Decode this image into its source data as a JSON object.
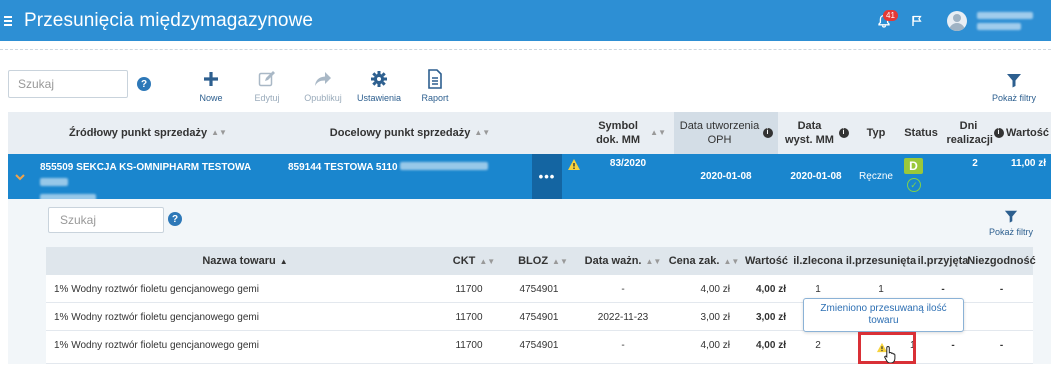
{
  "app": {
    "title": "Przesunięcia międzymagazynowe",
    "notifications_count": "41",
    "accent": "#2d8fd4"
  },
  "toolbar": {
    "search_placeholder": "Szukaj",
    "help_label": "?",
    "actions": [
      {
        "label": "Nowe",
        "icon": "plus-icon",
        "enabled": true
      },
      {
        "label": "Edytuj",
        "icon": "edit-icon",
        "enabled": false
      },
      {
        "label": "Opublikuj",
        "icon": "share-icon",
        "enabled": false
      },
      {
        "label": "Ustawienia",
        "icon": "gear-icon",
        "enabled": true
      },
      {
        "label": "Raport",
        "icon": "report-icon",
        "enabled": true
      }
    ],
    "filters_label": "Pokaż filtry"
  },
  "table": {
    "columns": {
      "source": "Źródłowy punkt sprzedaży",
      "target": "Docelowy punkt sprzedaży",
      "symbol": "Symbol dok. MM",
      "created": "Data utworzenia OPH",
      "sent": "Data wyst. MM",
      "type": "Typ",
      "status": "Status",
      "days": "Dni realizacji",
      "value": "Wartość"
    },
    "row": {
      "source": "855509 SEKCJA KS-OMNIPHARM TESTOWA",
      "target": "859144 TESTOWA 5110",
      "menu": "•••",
      "symbol": "83/2020",
      "created": "2020-01-08",
      "sent": "2020-01-08",
      "type": "Ręczne",
      "status_badge": "D",
      "days": "2",
      "value": "11,00 zł"
    }
  },
  "detail": {
    "search_placeholder": "Szukaj",
    "help_label": "?",
    "filters_label": "Pokaż filtry",
    "columns": {
      "name": "Nazwa towaru",
      "ckt": "CKT",
      "bloz": "BLOZ",
      "expiry": "Data ważn.",
      "price": "Cena zak.",
      "value": "Wartość",
      "ordered": "il.zlecona",
      "moved": "il.przesunięta",
      "received": "il.przyjęta",
      "mismatch": "Niezgodność"
    },
    "rows": [
      {
        "name": "1% Wodny roztwór fioletu gencjanowego gemi",
        "ckt": "11700",
        "bloz": "4754901",
        "expiry": "-",
        "price": "4,00 zł",
        "value": "4,00 zł",
        "ordered": "1",
        "moved": "1",
        "received": "-",
        "mismatch": "-"
      },
      {
        "name": "1% Wodny roztwór fioletu gencjanowego gemi",
        "ckt": "11700",
        "bloz": "4754901",
        "expiry": "2022-11-23",
        "price": "3,00 zł",
        "value": "3,00 zł",
        "ordered": "",
        "moved": "",
        "received": "",
        "mismatch": ""
      },
      {
        "name": "1% Wodny roztwór fioletu gencjanowego gemi",
        "ckt": "11700",
        "bloz": "4754901",
        "expiry": "-",
        "price": "4,00 zł",
        "value": "4,00 zł",
        "ordered": "2",
        "moved": "1",
        "received": "-",
        "mismatch": "-"
      }
    ],
    "tooltip": "Zmieniono przesuwaną ilość towaru"
  }
}
